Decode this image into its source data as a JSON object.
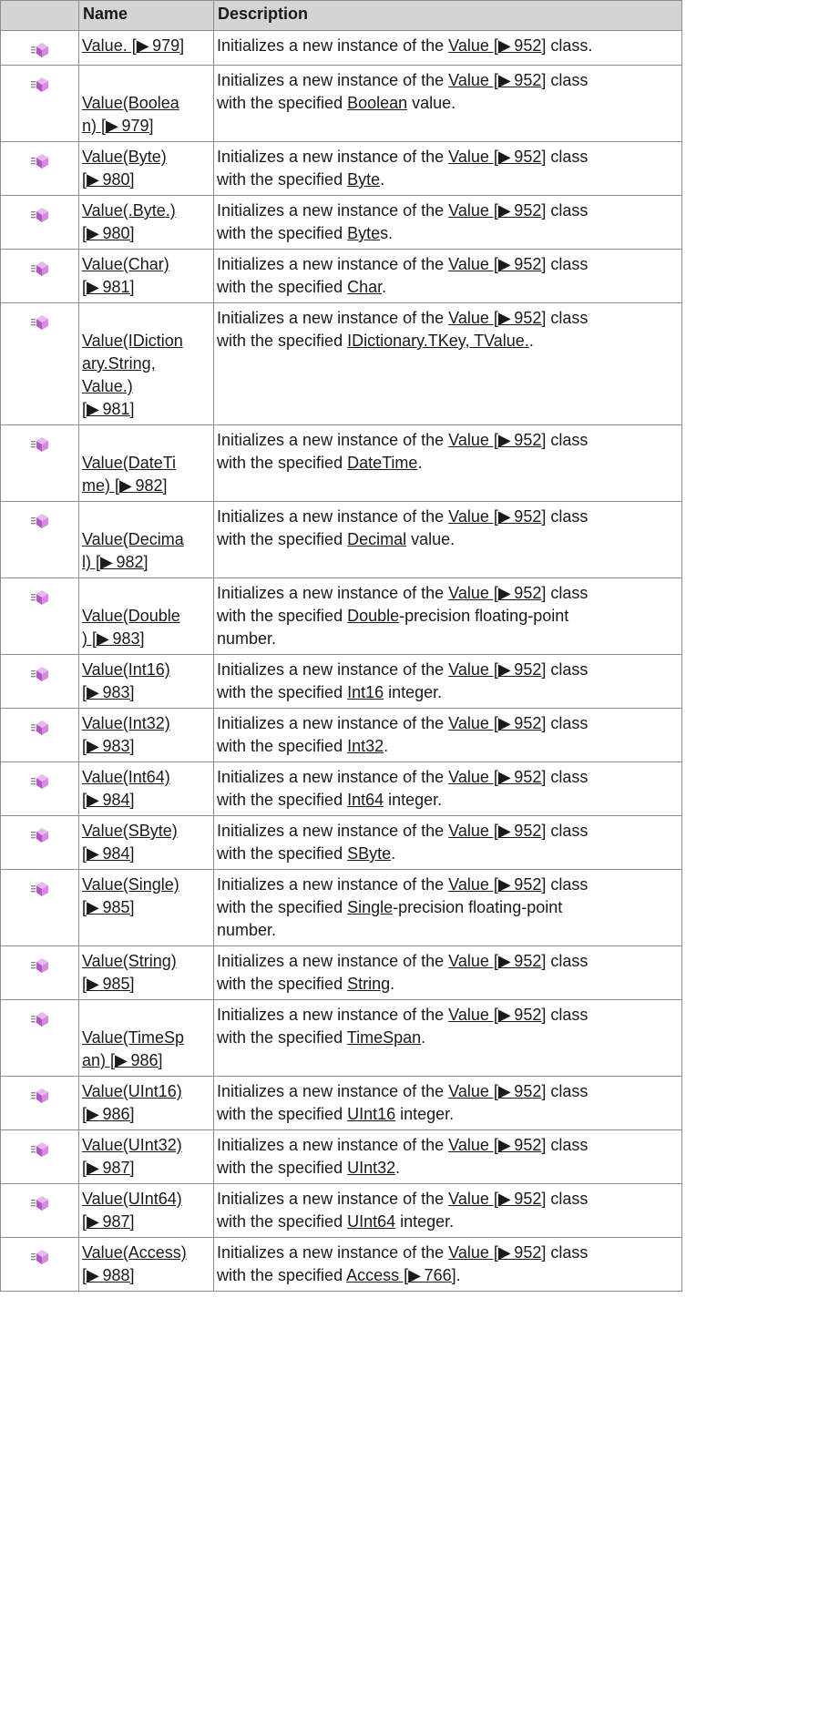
{
  "headers": {
    "icon": "",
    "name": "Name",
    "description": "Description"
  },
  "desc_prefix": "Initializes a new instance of the ",
  "desc_class_link": "Value [▶ 952]",
  "desc_class_word": " class",
  "desc_with": "with the specified ",
  "row_icon": "method-icon",
  "rows": [
    {
      "name": [
        "Value. [▶ 979]"
      ],
      "d1": "Initializes a new instance of the ",
      "d1link": "Value [▶ 952]",
      "d1tail": " class.",
      "d2": "",
      "d2link": "",
      "d2tail": "",
      "d3": ""
    },
    {
      "name": [
        "",
        "Value(Boolea",
        "n) [▶ 979]"
      ],
      "d1": "Initializes a new instance of the ",
      "d1link": "Value [▶ 952]",
      "d1tail": " class",
      "d2": "with the specified ",
      "d2link": "Boolean",
      "d2tail": " value.",
      "d3": ""
    },
    {
      "name": [
        "Value(Byte)",
        "[▶ 980]"
      ],
      "d1": "Initializes a new instance of the ",
      "d1link": "Value [▶ 952]",
      "d1tail": " class",
      "d2": "with the specified ",
      "d2link": "Byte",
      "d2tail": ".",
      "d3": ""
    },
    {
      "name": [
        "Value(.Byte.)",
        "[▶ 980]"
      ],
      "d1": "Initializes a new instance of the ",
      "d1link": "Value [▶ 952]",
      "d1tail": " class",
      "d2": "with the specified ",
      "d2link": "Byte",
      "d2tail": "s.",
      "d3": ""
    },
    {
      "name": [
        "Value(Char)",
        "[▶ 981]"
      ],
      "d1": "Initializes a new instance of the ",
      "d1link": "Value [▶ 952]",
      "d1tail": " class",
      "d2": "with the specified ",
      "d2link": "Char",
      "d2tail": ".",
      "d3": ""
    },
    {
      "name": [
        "",
        "Value(IDiction",
        "ary.String,",
        "Value.)",
        "[▶ 981]"
      ],
      "d1": "Initializes a new instance of the ",
      "d1link": "Value [▶ 952]",
      "d1tail": " class",
      "d2": "with the specified ",
      "d2link": "IDictionary.TKey, TValue.",
      "d2tail": ".",
      "d3": ""
    },
    {
      "name": [
        "",
        "Value(DateTi",
        "me) [▶ 982]"
      ],
      "d1": "Initializes a new instance of the ",
      "d1link": "Value [▶ 952]",
      "d1tail": " class",
      "d2": "with the specified ",
      "d2link": "DateTime",
      "d2tail": ".",
      "d3": ""
    },
    {
      "name": [
        "",
        "Value(Decima",
        "l) [▶ 982]"
      ],
      "d1": "Initializes a new instance of the ",
      "d1link": "Value [▶ 952]",
      "d1tail": " class",
      "d2": "with the specified ",
      "d2link": "Decimal",
      "d2tail": " value.",
      "d3": ""
    },
    {
      "name": [
        "",
        "Value(Double",
        ") [▶ 983]"
      ],
      "d1": "Initializes a new instance of the ",
      "d1link": "Value [▶ 952]",
      "d1tail": " class",
      "d2": "with the specified ",
      "d2link": "Double",
      "d2tail": "-precision floating-point",
      "d3": "number."
    },
    {
      "name": [
        "Value(Int16)",
        "[▶ 983]"
      ],
      "d1": "Initializes a new instance of the ",
      "d1link": "Value [▶ 952]",
      "d1tail": " class",
      "d2": "with the specified ",
      "d2link": "Int16",
      "d2tail": " integer.",
      "d3": ""
    },
    {
      "name": [
        "Value(Int32)",
        "[▶ 983]"
      ],
      "d1": "Initializes a new instance of the ",
      "d1link": "Value [▶ 952]",
      "d1tail": " class",
      "d2": "with the specified ",
      "d2link": "Int32",
      "d2tail": ".",
      "d3": ""
    },
    {
      "name": [
        "Value(Int64)",
        "[▶ 984]"
      ],
      "d1": "Initializes a new instance of the ",
      "d1link": "Value [▶ 952]",
      "d1tail": " class",
      "d2": "with the specified ",
      "d2link": "Int64",
      "d2tail": " integer.",
      "d3": ""
    },
    {
      "name": [
        "Value(SByte)",
        "[▶ 984]"
      ],
      "d1": "Initializes a new instance of the ",
      "d1link": "Value [▶ 952]",
      "d1tail": " class",
      "d2": "with the specified ",
      "d2link": "SByte",
      "d2tail": ".",
      "d3": ""
    },
    {
      "name": [
        "Value(Single)",
        "[▶ 985]"
      ],
      "d1": "Initializes a new instance of the ",
      "d1link": "Value [▶ 952]",
      "d1tail": " class",
      "d2": "with the specified ",
      "d2link": "Single",
      "d2tail": "-precision floating-point",
      "d3": "number."
    },
    {
      "name": [
        "Value(String)",
        "[▶ 985]"
      ],
      "d1": "Initializes a new instance of the ",
      "d1link": "Value [▶ 952]",
      "d1tail": " class",
      "d2": "with the specified ",
      "d2link": "String",
      "d2tail": ".",
      "d3": ""
    },
    {
      "name": [
        "",
        "Value(TimeSp",
        "an) [▶ 986]"
      ],
      "d1": "Initializes a new instance of the ",
      "d1link": "Value [▶ 952]",
      "d1tail": " class",
      "d2": "with the specified ",
      "d2link": "TimeSpan",
      "d2tail": ".",
      "d3": ""
    },
    {
      "name": [
        "Value(UInt16)",
        "[▶ 986]"
      ],
      "d1": "Initializes a new instance of the ",
      "d1link": "Value [▶ 952]",
      "d1tail": " class",
      "d2": "with the specified ",
      "d2link": "UInt16",
      "d2tail": " integer.",
      "d3": ""
    },
    {
      "name": [
        "Value(UInt32)",
        "[▶ 987]"
      ],
      "d1": "Initializes a new instance of the ",
      "d1link": "Value [▶ 952]",
      "d1tail": " class",
      "d2": "with the specified ",
      "d2link": "UInt32",
      "d2tail": ".",
      "d3": ""
    },
    {
      "name": [
        "Value(UInt64)",
        "[▶ 987]"
      ],
      "d1": "Initializes a new instance of the ",
      "d1link": "Value [▶ 952]",
      "d1tail": " class",
      "d2": "with the specified ",
      "d2link": "UInt64",
      "d2tail": " integer.",
      "d3": ""
    },
    {
      "name": [
        "Value(Access)",
        "[▶ 988]"
      ],
      "d1": "Initializes a new instance of the ",
      "d1link": "Value [▶ 952]",
      "d1tail": " class",
      "d2": "with the specified ",
      "d2link": "Access [▶ 766]",
      "d2tail": ".",
      "d3": ""
    }
  ]
}
